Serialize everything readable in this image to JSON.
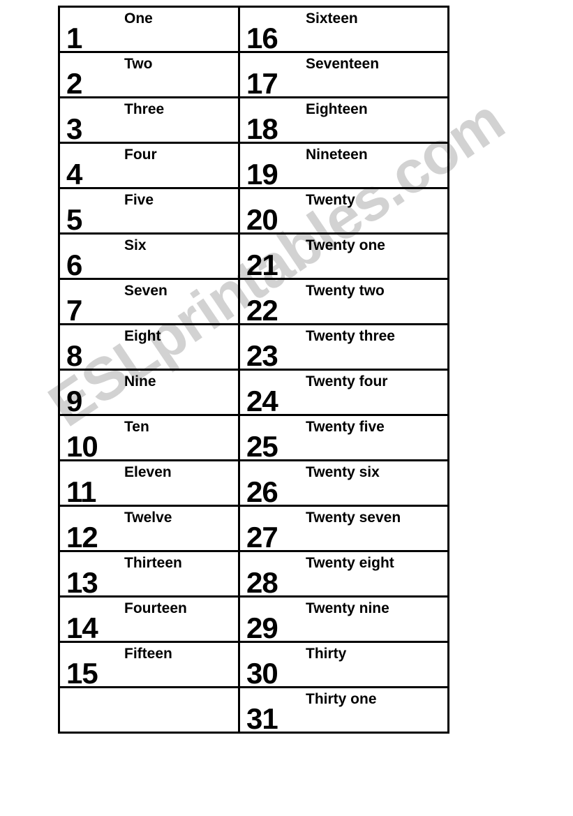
{
  "document": {
    "title": "Numbers 1 to 31 worksheet",
    "watermark": {
      "text": "ESLprintables.com",
      "color": "#d2d2d2",
      "rotation_deg": -34
    },
    "ink_color": "#000000",
    "page_background": "#ffffff",
    "border_color": "#000000"
  },
  "table": {
    "columns": 2,
    "rows": 16,
    "left_column": [
      {
        "numeral": "1",
        "word": "One"
      },
      {
        "numeral": "2",
        "word": "Two"
      },
      {
        "numeral": "3",
        "word": "Three"
      },
      {
        "numeral": "4",
        "word": "Four"
      },
      {
        "numeral": "5",
        "word": "Five"
      },
      {
        "numeral": "6",
        "word": "Six"
      },
      {
        "numeral": "7",
        "word": "Seven"
      },
      {
        "numeral": "8",
        "word": "Eight"
      },
      {
        "numeral": "9",
        "word": "Nine"
      },
      {
        "numeral": "10",
        "word": "Ten"
      },
      {
        "numeral": "11",
        "word": "Eleven"
      },
      {
        "numeral": "12",
        "word": "Twelve"
      },
      {
        "numeral": "13",
        "word": "Thirteen"
      },
      {
        "numeral": "14",
        "word": "Fourteen"
      },
      {
        "numeral": "15",
        "word": "Fifteen"
      },
      {
        "numeral": "",
        "word": ""
      }
    ],
    "right_column": [
      {
        "numeral": "16",
        "word": "Sixteen"
      },
      {
        "numeral": "17",
        "word": "Seventeen"
      },
      {
        "numeral": "18",
        "word": "Eighteen"
      },
      {
        "numeral": "19",
        "word": "Nineteen"
      },
      {
        "numeral": "20",
        "word": "Twenty"
      },
      {
        "numeral": "21",
        "word": "Twenty one"
      },
      {
        "numeral": "22",
        "word": "Twenty two"
      },
      {
        "numeral": "23",
        "word": "Twenty three"
      },
      {
        "numeral": "24",
        "word": "Twenty four"
      },
      {
        "numeral": "25",
        "word": "Twenty five"
      },
      {
        "numeral": "26",
        "word": "Twenty six"
      },
      {
        "numeral": "27",
        "word": "Twenty seven"
      },
      {
        "numeral": "28",
        "word": "Twenty eight"
      },
      {
        "numeral": "29",
        "word": "Twenty nine"
      },
      {
        "numeral": "30",
        "word": "Thirty"
      },
      {
        "numeral": "31",
        "word": "Thirty one"
      }
    ]
  }
}
